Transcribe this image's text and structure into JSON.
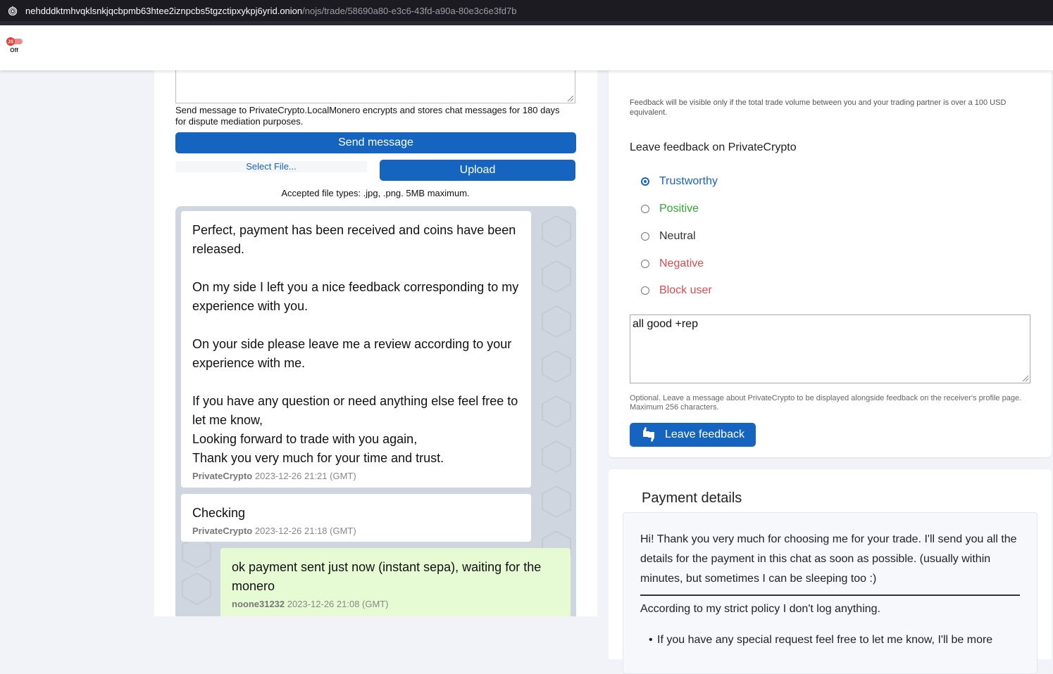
{
  "browser": {
    "url_host": "nehdddktmhvqklsnkjqcbpmb63htee2iznpcbs5tgzctipxykpj6yrid.onion",
    "url_path": "/nojs/trade/58690a80-e3c6-43fd-a90a-80e3c6e3fd7b"
  },
  "header": {
    "js_badge": "JS",
    "js_state": "Off"
  },
  "chat": {
    "send_note": "Send message to PrivateCrypto.LocalMonero encrypts and stores chat messages for 180 days for dispute mediation purposes.",
    "send_button": "Send message",
    "select_file": "Select File...",
    "upload_button": "Upload",
    "accepted_types": "Accepted file types: .jpg, .png. 5MB maximum.",
    "messages": [
      {
        "text": "Perfect, payment has been received and coins have been released.\n\nOn my side I left you a nice feedback corresponding to my experience with you.\n\nOn your side please leave me a review according to your experience with me.\n\nIf you have any question or need anything else feel free to let me know,\nLooking forward to trade with you again,\nThank you very much for your time and trust.",
        "author": "PrivateCrypto",
        "time": "2023-12-26 21:21 (GMT)"
      },
      {
        "text": "Checking",
        "author": "PrivateCrypto",
        "time": "2023-12-26 21:18 (GMT)"
      },
      {
        "text": "ok payment sent just now (instant sepa), waiting for the monero",
        "author": "noone31232",
        "time": "2023-12-26 21:08 (GMT)"
      }
    ]
  },
  "feedback": {
    "note": "Feedback will be visible only if the total trade volume between you and your trading partner is over a 100 USD equivalent.",
    "heading": "Leave feedback on PrivateCrypto",
    "options": [
      {
        "label": "Trustworthy",
        "color": "#1565c0",
        "checked": true
      },
      {
        "label": "Positive",
        "color": "#2eaa2e",
        "checked": false
      },
      {
        "label": "Neutral",
        "color": "#333333",
        "checked": false
      },
      {
        "label": "Negative",
        "color": "#e5484d",
        "checked": false
      },
      {
        "label": "Block user",
        "color": "#e5484d",
        "checked": false
      }
    ],
    "message_value": "all good +rep",
    "help": "Optional. Leave a message about PrivateCrypto to be displayed alongside feedback on the receiver's profile page. Maximum 256 characters.",
    "button": "Leave feedback",
    "button_icon": "thumbs-up-down-icon"
  },
  "payment": {
    "title": "Payment details",
    "intro": "Hi! Thank you very much for choosing me for your trade. I'll send you all the details for the payment in this chat as soon as possible. (usually within minutes, but sometimes I can be sleeping too :)",
    "policy": "According to my strict policy I don't log anything.",
    "bullet_first": "If you have any special request feel free to let me know, I'll be more"
  },
  "colors": {
    "accent": "#1565c0",
    "chat_bg": "#cfd6e0",
    "own_bubble": "#e6fbd4"
  }
}
